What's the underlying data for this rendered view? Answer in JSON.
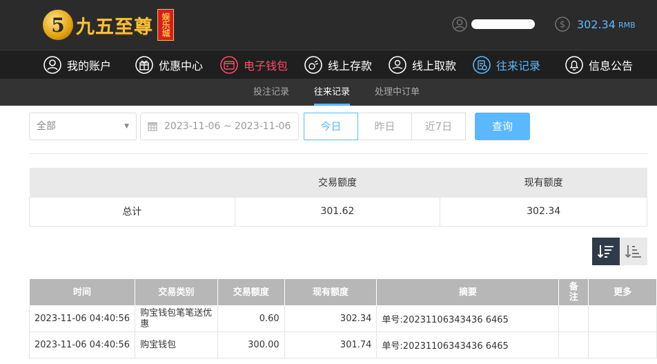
{
  "header": {
    "logo_mark": "5",
    "logo_text": "九五至尊",
    "logo_sub": "娱乐城",
    "balance": "302.34",
    "currency": "RMB",
    "accent_color": "#5bb8ff"
  },
  "nav": {
    "items": [
      {
        "label": "我的账户",
        "icon": "user-icon"
      },
      {
        "label": "优惠中心",
        "icon": "gift-icon"
      },
      {
        "label": "电子钱包",
        "icon": "wallet-icon"
      },
      {
        "label": "线上存款",
        "icon": "deposit-icon"
      },
      {
        "label": "线上取款",
        "icon": "withdraw-icon"
      },
      {
        "label": "往来记录",
        "icon": "records-icon"
      },
      {
        "label": "信息公告",
        "icon": "bell-icon"
      }
    ]
  },
  "subnav": {
    "items": [
      "投注记录",
      "往来记录",
      "处理中订单"
    ],
    "active": "往来记录"
  },
  "filter": {
    "type_value": "全部",
    "date_range": "2023-11-06 ~ 2023-11-06",
    "quick": [
      "今日",
      "昨日",
      "近7日"
    ],
    "query_label": "查询"
  },
  "summary": {
    "headers": [
      "",
      "交易额度",
      "现有额度"
    ],
    "row": [
      "总计",
      "301.62",
      "302.34"
    ]
  },
  "records": {
    "headers": [
      "时间",
      "交易类别",
      "交易额度",
      "现有额度",
      "摘要",
      "备注",
      "更多"
    ],
    "rows": [
      [
        "2023-11-06 04:40:56",
        "购宝钱包笔笔送优惠",
        "0.60",
        "302.34",
        "单号:20231106343436 6465",
        "",
        ""
      ],
      [
        "2023-11-06 04:40:56",
        "购宝钱包",
        "300.00",
        "301.74",
        "单号:20231106343436 6465",
        "",
        ""
      ]
    ]
  }
}
